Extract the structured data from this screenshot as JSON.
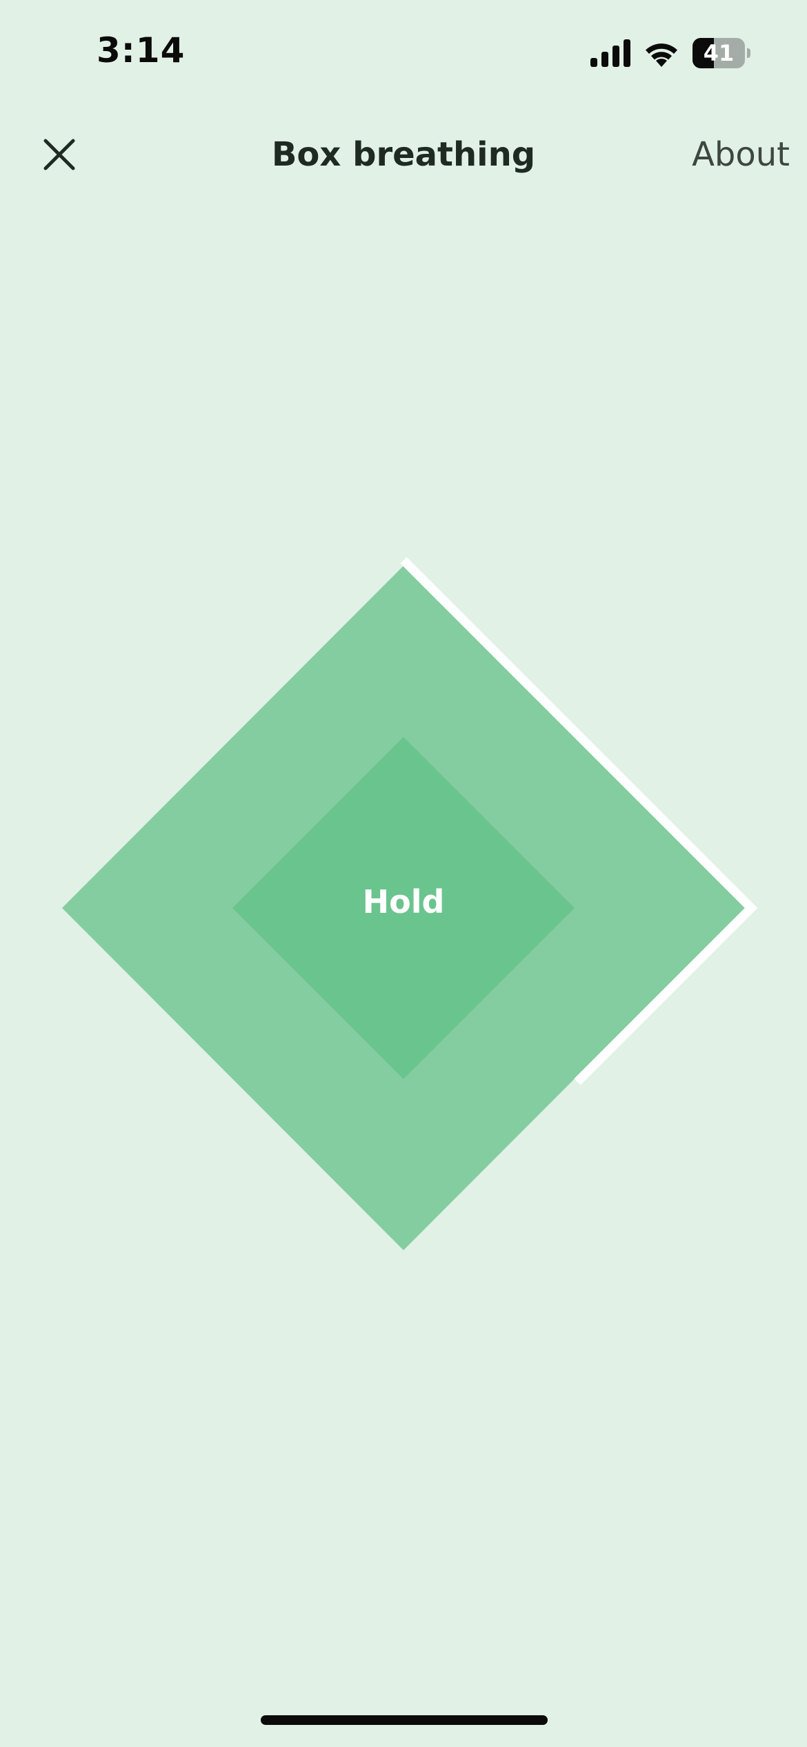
{
  "status_bar": {
    "time": "3:14",
    "battery_percent": "41",
    "icons": [
      "signal-icon",
      "wifi-icon",
      "battery-icon"
    ]
  },
  "nav": {
    "close_icon": "close-icon",
    "title": "Box breathing",
    "about_label": "About"
  },
  "exercise": {
    "phase": "Hold",
    "progress_fraction": 0.375,
    "colors": {
      "background": "#e1f1e6",
      "outer_diamond": "#84cda0",
      "inner_diamond": "#6ac48d",
      "progress_trace": "#ffffff"
    }
  }
}
